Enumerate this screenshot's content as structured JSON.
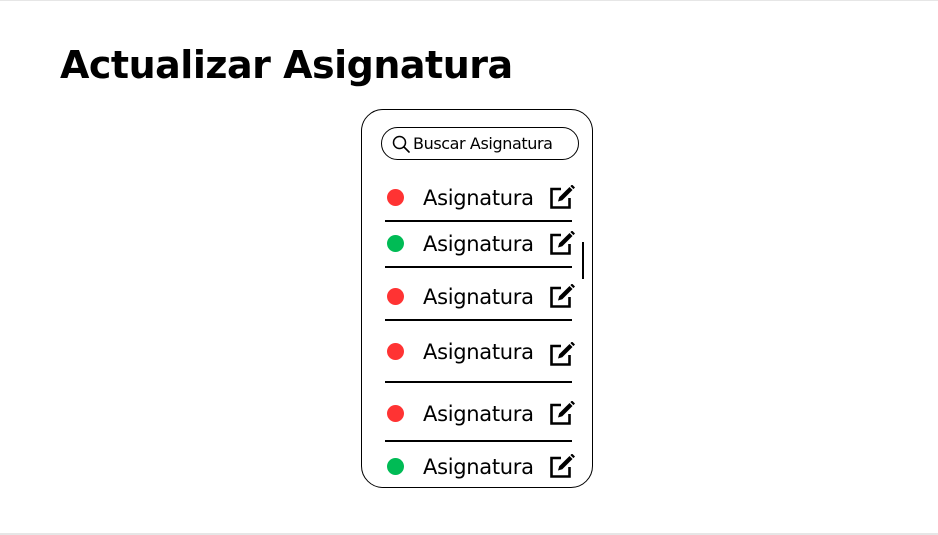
{
  "page": {
    "title": "Actualizar Asignatura"
  },
  "search": {
    "placeholder": "Buscar Asignatura"
  },
  "status_colors": {
    "red": "#ff3333",
    "green": "#00bb55"
  },
  "icons": {
    "search": "search-icon",
    "edit": "edit-icon"
  },
  "list": {
    "items": [
      {
        "label": "Asignatura",
        "status": "red"
      },
      {
        "label": "Asignatura",
        "status": "green"
      },
      {
        "label": "Asignatura",
        "status": "red"
      },
      {
        "label": "Asignatura",
        "status": "red"
      },
      {
        "label": "Asignatura",
        "status": "red"
      },
      {
        "label": "Asignatura",
        "status": "green"
      }
    ]
  }
}
